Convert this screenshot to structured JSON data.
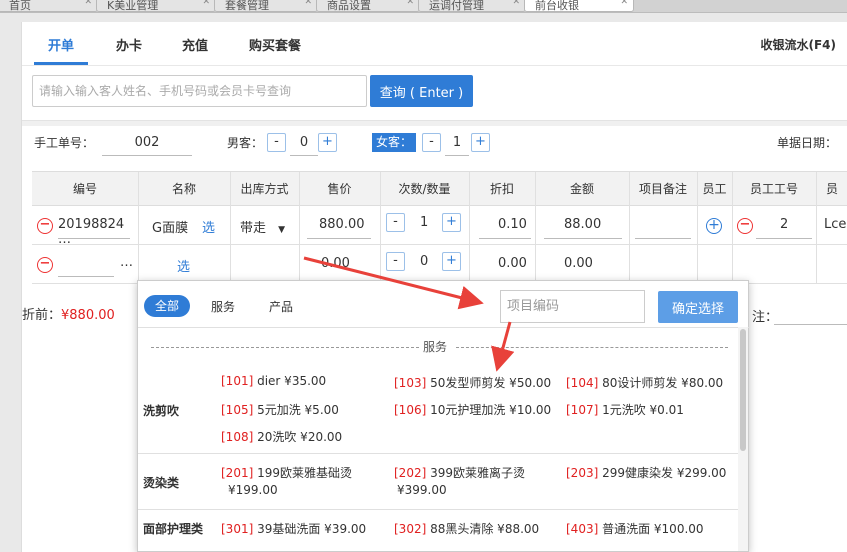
{
  "browser_tabs": [
    "首页",
    "K美业管理",
    "套餐管理",
    "商品设置",
    "运调付管理",
    "前台收银"
  ],
  "main_tabs": [
    "开单",
    "办卡",
    "充值",
    "购买套餐"
  ],
  "flow_label": "收银流水(F4)",
  "search": {
    "placeholder": "请输入输入客人姓名、手机号码或会员卡号查询",
    "button": "查询 ( Enter )"
  },
  "order": {
    "manual_no_label": "手工单号：",
    "manual_no": "002",
    "male_label": "男客：",
    "male_count": "0",
    "female_label": "女客：",
    "female_count": "1",
    "date_label": "单据日期："
  },
  "columns": [
    "编号",
    "名称",
    "出库方式",
    "售价",
    "次数/数量",
    "折扣",
    "金额",
    "项目备注",
    "员工",
    "员工工号",
    "员"
  ],
  "rows": [
    {
      "code": "20198824 …",
      "name": "G面膜",
      "select": "选",
      "method": "带走",
      "price": "880.00",
      "qty": "1",
      "discount": "0.10",
      "amount": "88.00",
      "staff_no": "2",
      "staff_extra": "Lce"
    },
    {
      "code": "…",
      "select": "选",
      "price": "0.00",
      "qty": "0",
      "discount": "0.00",
      "amount": "0.00"
    }
  ],
  "footer": {
    "before_discount_label": "折前：",
    "before_discount": "¥880.00",
    "right_label": "注："
  },
  "popup": {
    "types": [
      "全部",
      "服务",
      "产品"
    ],
    "code_placeholder": "项目编码",
    "confirm": "确定选择",
    "divider": "服务",
    "categories": [
      {
        "name": "洗剪吹",
        "items": [
          {
            "code": "[101]",
            "text": " dier ¥35.00"
          },
          {
            "code": "[103]",
            "text": " 50发型师剪发 ¥50.00"
          },
          {
            "code": "[104]",
            "text": " 80设计师剪发 ¥80.00"
          },
          {
            "code": "[105]",
            "text": " 5元加洗 ¥5.00"
          },
          {
            "code": "[106]",
            "text": " 10元护理加洗 ¥10.00"
          },
          {
            "code": "[107]",
            "text": " 1元洗吹 ¥0.01"
          },
          {
            "code": "[108]",
            "text": " 20洗吹 ¥20.00"
          }
        ]
      },
      {
        "name": "烫染类",
        "items": [
          {
            "code": "[201]",
            "text": " 199欧莱雅基础烫",
            "text2": "¥199.00"
          },
          {
            "code": "[202]",
            "text": " 399欧莱雅离子烫",
            "text2": "¥399.00"
          },
          {
            "code": "[203]",
            "text": " 299健康染发 ¥299.00"
          }
        ]
      },
      {
        "name": "面部护理类",
        "items": [
          {
            "code": "[301]",
            "text": " 39基础洗面 ¥39.00"
          },
          {
            "code": "[302]",
            "text": " 88黑头清除 ¥88.00"
          },
          {
            "code": "[403]",
            "text": " 普通洗面 ¥100.00"
          }
        ]
      }
    ]
  },
  "colors": {
    "accent": "#2f7cd6",
    "price_red": "#e02020",
    "arrow_red": "#e8413a"
  }
}
